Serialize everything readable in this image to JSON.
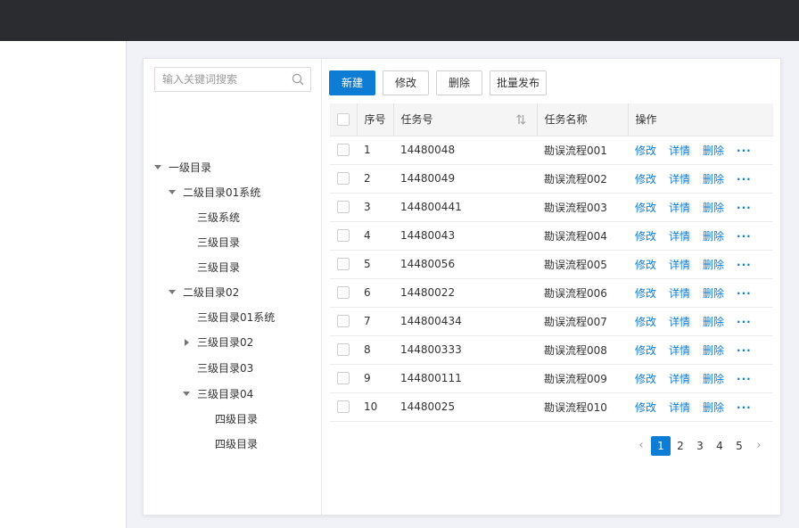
{
  "search": {
    "placeholder": "输入关键词搜索",
    "value": ""
  },
  "tree": {
    "nodes": [
      {
        "label": "一级目录",
        "state": "expanded"
      },
      {
        "label": "二级目录01系统",
        "state": "expanded"
      },
      {
        "label": "三级系统",
        "state": "leaf"
      },
      {
        "label": "三级目录",
        "state": "leaf"
      },
      {
        "label": "三级目录",
        "state": "leaf"
      },
      {
        "label": "二级目录02",
        "state": "expanded"
      },
      {
        "label": "三级目录01系统",
        "state": "leaf"
      },
      {
        "label": "三级目录02",
        "state": "collapsed"
      },
      {
        "label": "三级目录03",
        "state": "leaf"
      },
      {
        "label": "三级目录04",
        "state": "expanded"
      },
      {
        "label": "四级目录",
        "state": "leaf"
      },
      {
        "label": "四级目录",
        "state": "leaf"
      }
    ]
  },
  "toolbar": {
    "new_label": "新建",
    "edit_label": "修改",
    "delete_label": "删除",
    "batch_publish_label": "批量发布"
  },
  "table": {
    "headers": {
      "index": "序号",
      "task_no": "任务号",
      "task_name": "任务名称",
      "actions": "操作"
    },
    "action_labels": {
      "edit": "修改",
      "detail": "详情",
      "delete": "删除",
      "more": "···"
    },
    "rows": [
      {
        "index": "1",
        "task_no": "14480048",
        "task_name": "勘误流程001"
      },
      {
        "index": "2",
        "task_no": "14480049",
        "task_name": "勘误流程002"
      },
      {
        "index": "3",
        "task_no": "144800441",
        "task_name": "勘误流程003"
      },
      {
        "index": "4",
        "task_no": "14480043",
        "task_name": "勘误流程004"
      },
      {
        "index": "5",
        "task_no": "14480056",
        "task_name": "勘误流程005"
      },
      {
        "index": "6",
        "task_no": "14480022",
        "task_name": "勘误流程006"
      },
      {
        "index": "7",
        "task_no": "144800434",
        "task_name": "勘误流程007"
      },
      {
        "index": "8",
        "task_no": "144800333",
        "task_name": "勘误流程008"
      },
      {
        "index": "9",
        "task_no": "144800111",
        "task_name": "勘误流程009"
      },
      {
        "index": "10",
        "task_no": "14480025",
        "task_name": "勘误流程010"
      }
    ]
  },
  "pagination": {
    "prev": "‹",
    "next": "›",
    "pages": [
      "1",
      "2",
      "3",
      "4",
      "5"
    ],
    "current": "1"
  },
  "colors": {
    "accent": "#0c7cd5",
    "topbar": "#2b2c30",
    "background": "#f0f2f8"
  }
}
